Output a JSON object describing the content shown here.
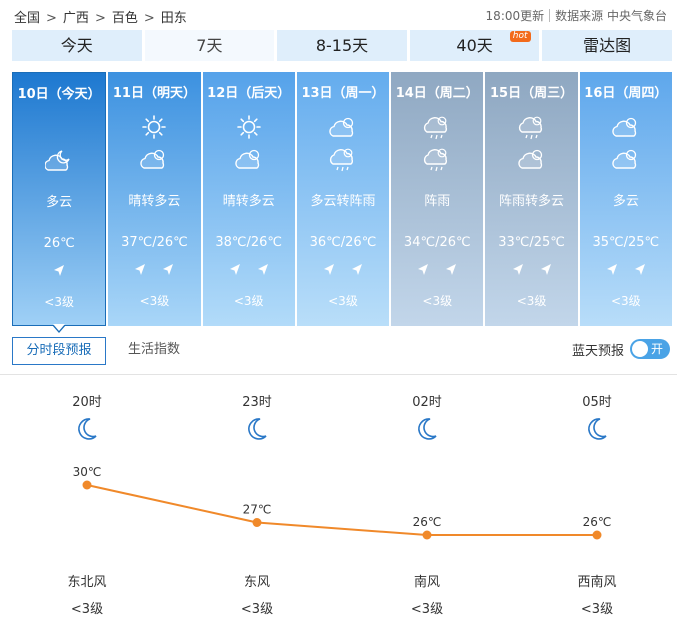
{
  "breadcrumb": {
    "items": [
      "全国",
      "广西",
      "百色",
      "田东"
    ],
    "separator": ">"
  },
  "source": {
    "update_time": "18:00更新",
    "label": "数据来源",
    "provider": "中央气象台"
  },
  "tabs": [
    {
      "label": "今天"
    },
    {
      "label": "7天"
    },
    {
      "label": "8-15天"
    },
    {
      "label": "40天",
      "badge": "hot"
    },
    {
      "label": "雷达图"
    }
  ],
  "colors": {
    "accent": "#1a6db8",
    "line": "#f0892a",
    "tab_bg": "#dfeefb"
  },
  "days": [
    {
      "date": "10日（今天）",
      "icon1": "none",
      "icon2": "cloudy-night-icon",
      "desc": "多云",
      "temp": "26℃",
      "wind_level": "<3级",
      "bg": [
        "#1d78d0",
        "#9fd0f6"
      ]
    },
    {
      "date": "11日（明天）",
      "icon1": "sun-icon",
      "icon2": "partly-cloudy-icon",
      "desc": "晴转多云",
      "temp": "37℃/26℃",
      "wind_level": "<3级",
      "bg": [
        "#3c91e0",
        "#a9d6f8"
      ]
    },
    {
      "date": "12日（后天）",
      "icon1": "sun-icon",
      "icon2": "partly-cloudy-icon",
      "desc": "晴转多云",
      "temp": "38℃/26℃",
      "wind_level": "<3级",
      "bg": [
        "#55a2ea",
        "#b2dbf9"
      ]
    },
    {
      "date": "13日（周一）",
      "icon1": "partly-cloudy-icon",
      "icon2": "shower-icon",
      "desc": "多云转阵雨",
      "temp": "36℃/26℃",
      "wind_level": "<3级",
      "bg": [
        "#64acee",
        "#b9def9"
      ]
    },
    {
      "date": "14日（周二）",
      "icon1": "shower-icon",
      "icon2": "shower-icon",
      "desc": "阵雨",
      "temp": "34℃/26℃",
      "wind_level": "<3级",
      "bg": [
        "#8fa8c2",
        "#c2d6ea"
      ]
    },
    {
      "date": "15日（周三）",
      "icon1": "shower-icon",
      "icon2": "partly-cloudy-icon",
      "desc": "阵雨转多云",
      "temp": "33℃/25℃",
      "wind_level": "<3级",
      "bg": [
        "#8ea7c1",
        "#c2d6ea"
      ]
    },
    {
      "date": "16日（周四）",
      "icon1": "partly-cloudy-icon",
      "icon2": "partly-cloudy-icon",
      "desc": "多云",
      "temp": "35℃/25℃",
      "wind_level": "<3级",
      "bg": [
        "#5ea7ec",
        "#b8ddf9"
      ]
    }
  ],
  "subtabs": {
    "active": "分时段预报",
    "other": "生活指数"
  },
  "bluesky": {
    "label": "蓝天预报",
    "toggle": "开"
  },
  "hourly": [
    {
      "time": "20时",
      "icon": "moon-icon",
      "temp": "30℃",
      "wind_dir": "东北风",
      "wind_level": "<3级"
    },
    {
      "time": "23时",
      "icon": "moon-icon",
      "temp": "27℃",
      "wind_dir": "东风",
      "wind_level": "<3级"
    },
    {
      "time": "02时",
      "icon": "moon-icon",
      "temp": "26℃",
      "wind_dir": "南风",
      "wind_level": "<3级"
    },
    {
      "time": "05时",
      "icon": "moon-icon",
      "temp": "26℃",
      "wind_dir": "西南风",
      "wind_level": "<3级"
    }
  ],
  "chart_data": {
    "type": "line",
    "categories": [
      "20时",
      "23时",
      "02时",
      "05时"
    ],
    "values": [
      30,
      27,
      26,
      26
    ]
  }
}
